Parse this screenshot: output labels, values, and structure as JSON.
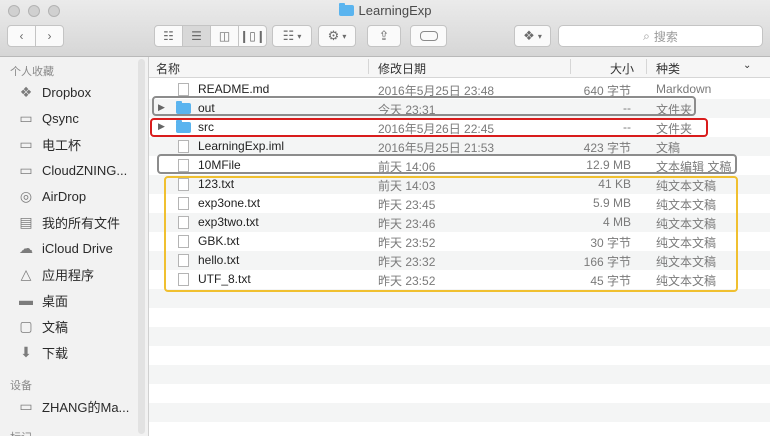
{
  "window": {
    "title": "LearningExp"
  },
  "toolbar": {
    "back_icon": "chevron-left-icon",
    "forward_icon": "chevron-right-icon",
    "view_modes": [
      "icon-view-icon",
      "list-view-icon",
      "column-view-icon",
      "cover-flow-icon"
    ],
    "search_placeholder": "搜索"
  },
  "sidebar": {
    "favorites_heading": "个人收藏",
    "items": [
      {
        "label": "Dropbox",
        "icon": "dropbox-icon"
      },
      {
        "label": "Qsync",
        "icon": "folder-icon"
      },
      {
        "label": "电工杯",
        "icon": "folder-icon"
      },
      {
        "label": "CloudZNING...",
        "icon": "folder-icon"
      },
      {
        "label": "AirDrop",
        "icon": "airdrop-icon"
      },
      {
        "label": "我的所有文件",
        "icon": "all-files-icon"
      },
      {
        "label": "iCloud Drive",
        "icon": "cloud-icon"
      },
      {
        "label": "应用程序",
        "icon": "applications-icon"
      },
      {
        "label": "桌面",
        "icon": "desktop-icon"
      },
      {
        "label": "文稿",
        "icon": "documents-icon"
      },
      {
        "label": "下载",
        "icon": "download-icon"
      }
    ],
    "devices_heading": "设备",
    "devices": [
      {
        "label": "ZHANG的Ma...",
        "icon": "computer-icon"
      }
    ],
    "tags_heading": "标记"
  },
  "columns": {
    "name": "名称",
    "date": "修改日期",
    "size": "大小",
    "kind": "种类"
  },
  "files": [
    {
      "name": "README.md",
      "date": "2016年5月25日 23:48",
      "size": "640 字节",
      "kind": "Markdown",
      "folder": false
    },
    {
      "name": "out",
      "date": "今天 23:31",
      "size": "--",
      "kind": "文件夹",
      "folder": true
    },
    {
      "name": "src",
      "date": "2016年5月26日 22:45",
      "size": "--",
      "kind": "文件夹",
      "folder": true
    },
    {
      "name": "LearningExp.iml",
      "date": "2016年5月25日 21:53",
      "size": "423 字节",
      "kind": "文稿",
      "folder": false
    },
    {
      "name": "10MFile",
      "date": "前天 14:06",
      "size": "12.9 MB",
      "kind": "文本编辑 文稿",
      "folder": false
    },
    {
      "name": "123.txt",
      "date": "前天 14:03",
      "size": "41 KB",
      "kind": "纯文本文稿",
      "folder": false
    },
    {
      "name": "exp3one.txt",
      "date": "昨天 23:45",
      "size": "5.9 MB",
      "kind": "纯文本文稿",
      "folder": false
    },
    {
      "name": "exp3two.txt",
      "date": "昨天 23:46",
      "size": "4 MB",
      "kind": "纯文本文稿",
      "folder": false
    },
    {
      "name": "GBK.txt",
      "date": "昨天 23:52",
      "size": "30 字节",
      "kind": "纯文本文稿",
      "folder": false
    },
    {
      "name": "hello.txt",
      "date": "昨天 23:32",
      "size": "166 字节",
      "kind": "纯文本文稿",
      "folder": false
    },
    {
      "name": "UTF_8.txt",
      "date": "昨天 23:52",
      "size": "45 字节",
      "kind": "纯文本文稿",
      "folder": false
    }
  ],
  "highlight_colors": {
    "gray": "#8c8c8c",
    "red": "#d91c1c",
    "yellow": "#f0c030"
  }
}
